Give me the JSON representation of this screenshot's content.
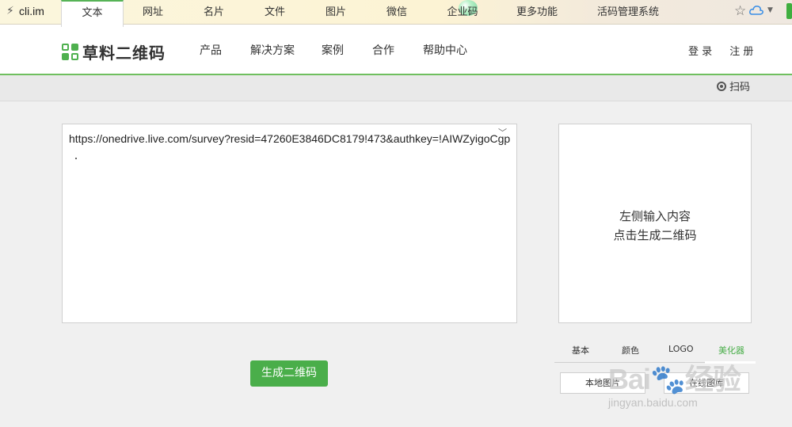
{
  "browser": {
    "url": "cli.im",
    "colors": {
      "bg": "#fbf6dd"
    }
  },
  "header": {
    "logo_text": "草料二维码",
    "nav": [
      "产品",
      "解决方案",
      "案例",
      "合作",
      "帮助中心"
    ],
    "login": "登 录",
    "register": "注 册"
  },
  "tabs": {
    "items": [
      "文本",
      "网址",
      "名片",
      "文件",
      "图片",
      "微信",
      "企业码",
      "更多功能",
      "活码管理系统"
    ],
    "active": "文本",
    "scan_label": "扫码"
  },
  "editor": {
    "value": "https://onedrive.live.com/survey?resid=47260E3846DC8179!473&authkey=!AIWZyigoCgp"
  },
  "preview": {
    "line1": "左侧输入内容",
    "line2": "点击生成二维码"
  },
  "generate_button": "生成二维码",
  "options": {
    "tabs": [
      "基本",
      "颜色",
      "LOGO",
      "美化器"
    ],
    "active_tab": "美化器",
    "buttons": [
      "本地图片",
      "在线图库"
    ]
  },
  "watermark": {
    "big": "Bai🐾经验",
    "small": "jingyan.baidu.com"
  },
  "colors": {
    "accent": "#4aae4a",
    "tab_bar": "#e9e9e9"
  }
}
